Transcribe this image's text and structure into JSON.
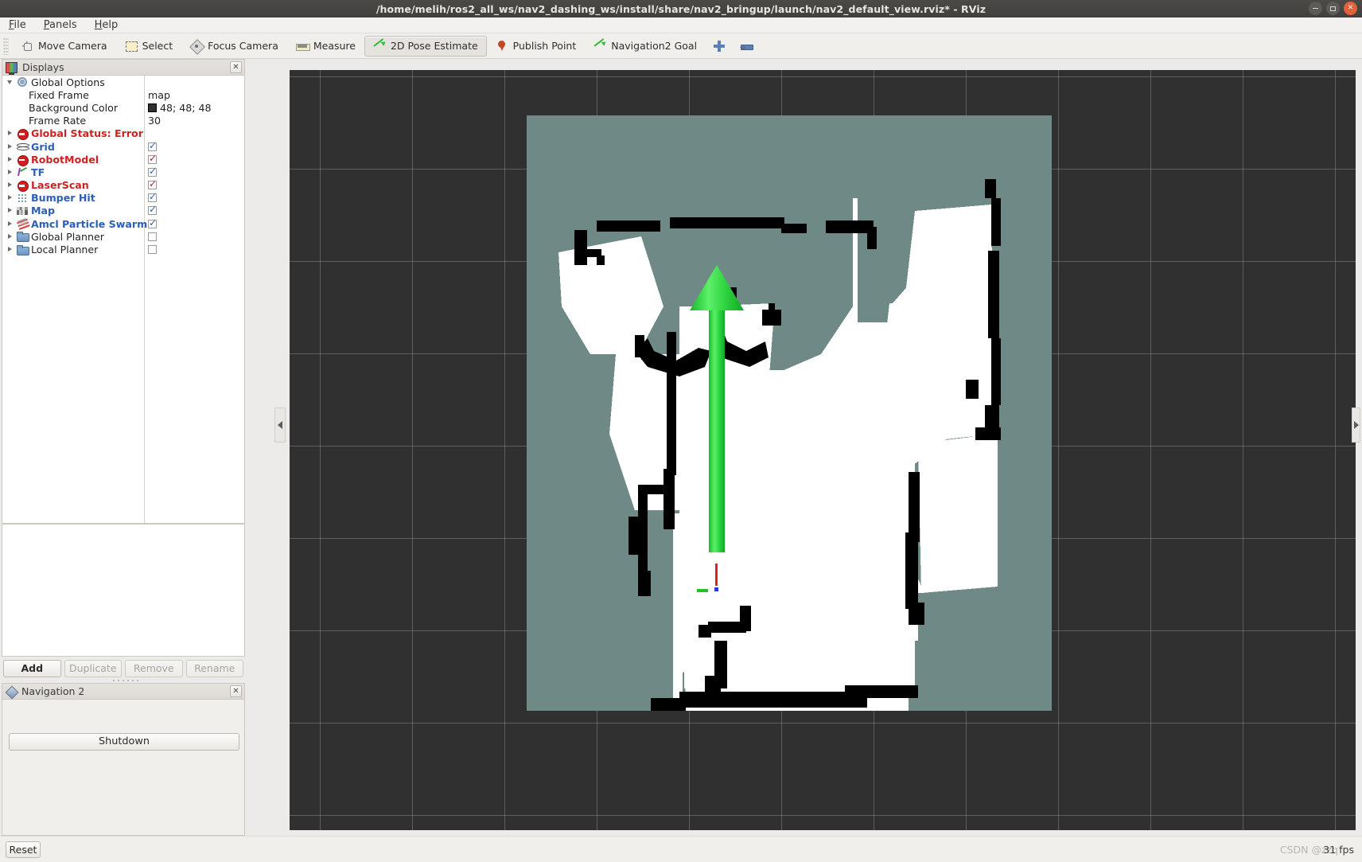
{
  "window": {
    "title": "/home/melih/ros2_all_ws/nav2_dashing_ws/install/share/nav2_bringup/launch/nav2_default_view.rviz* - RViz",
    "controls": {
      "minimize": "minimize-button",
      "maximize": "maximize-button",
      "close": "close-button"
    }
  },
  "menubar": {
    "items": [
      {
        "label": "File",
        "mnemonic": "F"
      },
      {
        "label": "Panels",
        "mnemonic": "P"
      },
      {
        "label": "Help",
        "mnemonic": "H"
      }
    ]
  },
  "toolbar": {
    "buttons": [
      {
        "label": "Move Camera",
        "icon": "move-camera-icon",
        "active": false
      },
      {
        "label": "Select",
        "icon": "select-icon",
        "active": false
      },
      {
        "label": "Focus Camera",
        "icon": "focus-camera-icon",
        "active": false
      },
      {
        "label": "Measure",
        "icon": "measure-icon",
        "active": false
      },
      {
        "label": "2D Pose Estimate",
        "icon": "pose-estimate-arrow-icon",
        "active": true
      },
      {
        "label": "Publish Point",
        "icon": "map-pin-icon",
        "active": false
      },
      {
        "label": "Navigation2 Goal",
        "icon": "navigation-goal-arrow-icon",
        "active": false
      }
    ],
    "zoom_in_icon": "plus-icon",
    "zoom_out_icon": "minus-icon",
    "overflow_icon": "toolbar-overflow-chevron-icon"
  },
  "displays_panel": {
    "title": "Displays",
    "close_label": "✕",
    "rows": [
      {
        "name": "Global Options",
        "style": "plain",
        "twisty": "open",
        "icon": "gear-icon",
        "value": "",
        "check": null
      },
      {
        "name": "Fixed Frame",
        "style": "plain",
        "twisty": "none",
        "icon": "none",
        "value": "map",
        "check": null,
        "indent": true
      },
      {
        "name": "Background Color",
        "style": "plain",
        "twisty": "none",
        "icon": "none",
        "value": "48; 48; 48",
        "check": null,
        "indent": true,
        "swatch": "#303030"
      },
      {
        "name": "Frame Rate",
        "style": "plain",
        "twisty": "none",
        "icon": "none",
        "value": "30",
        "check": null,
        "indent": true
      },
      {
        "name": "Global Status: Error",
        "style": "red",
        "twisty": "closed",
        "icon": "error-circle-icon",
        "value": "",
        "check": null
      },
      {
        "name": "Grid",
        "style": "blue",
        "twisty": "closed",
        "icon": "grid-icon",
        "value": "",
        "check": "blue"
      },
      {
        "name": "RobotModel",
        "style": "red",
        "twisty": "closed",
        "icon": "error-circle-icon",
        "value": "",
        "check": "red"
      },
      {
        "name": "TF",
        "style": "blue",
        "twisty": "closed",
        "icon": "tf-axes-icon",
        "value": "",
        "check": "blue"
      },
      {
        "name": "LaserScan",
        "style": "red",
        "twisty": "closed",
        "icon": "error-circle-icon",
        "value": "",
        "check": "red"
      },
      {
        "name": "Bumper Hit",
        "style": "blue",
        "twisty": "closed",
        "icon": "pointcloud-icon",
        "value": "",
        "check": "blue"
      },
      {
        "name": "Map",
        "style": "blue",
        "twisty": "closed",
        "icon": "map-icon",
        "value": "",
        "check": "blue"
      },
      {
        "name": "Amcl Particle Swarm",
        "style": "blue",
        "twisty": "closed",
        "icon": "particle-swarm-icon",
        "value": "",
        "check": "blue"
      },
      {
        "name": "Global Planner",
        "style": "plain",
        "twisty": "closed",
        "icon": "folder-icon",
        "value": "",
        "check": "off"
      },
      {
        "name": "Local Planner",
        "style": "plain",
        "twisty": "closed",
        "icon": "folder-icon",
        "value": "",
        "check": "off"
      }
    ]
  },
  "display_buttons": [
    {
      "label": "Add",
      "enabled": true
    },
    {
      "label": "Duplicate",
      "enabled": false
    },
    {
      "label": "Remove",
      "enabled": false
    },
    {
      "label": "Rename",
      "enabled": false
    }
  ],
  "navigation_panel": {
    "title": "Navigation 2",
    "close_label": "✕",
    "shutdown_label": "Shutdown"
  },
  "statusbar": {
    "reset_label": "Reset",
    "fps": "31 fps",
    "watermark": "CSDN @zzq"
  },
  "render_view": {
    "background_color": "#303030",
    "grid_color": "#c8c8c8",
    "grid_spacing_px": 116,
    "map": {
      "unknown_color": "#6f8a86",
      "free_color": "#ffffff",
      "occupied_color": "#000000"
    },
    "pose_arrow": {
      "color": "#35d943",
      "label": "2d-pose-estimate-arrow"
    },
    "tf_axes": {
      "x_color": "#e02020",
      "y_color": "#24c024",
      "z_color": "#2040e0"
    }
  }
}
